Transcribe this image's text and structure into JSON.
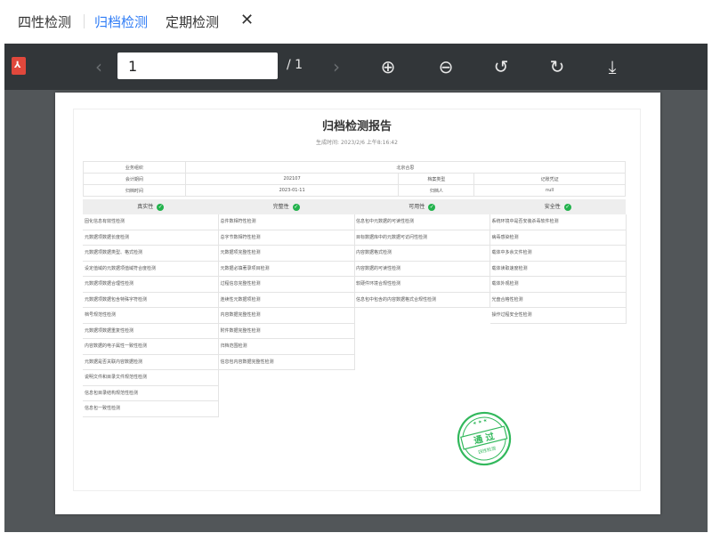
{
  "tabs": [
    "四性检测",
    "归档检测",
    "定期检测"
  ],
  "close_glyph": "✕",
  "toolbar": {
    "prev_icon": "‹",
    "page_value": "1",
    "page_total": "/ 1",
    "next_icon": "›",
    "zoom_in_icon": "⊕",
    "zoom_out_icon": "⊖",
    "rotate_left_icon": "↺",
    "rotate_right_icon": "↻",
    "download_icon": "⤓"
  },
  "report": {
    "title": "归档检测报告",
    "generated": "生成时间: 2023/2/6 上午8:16:42",
    "info_rows": [
      [
        "业务组织",
        "北京合思"
      ],
      [
        "会计期间",
        "202107",
        "档案类型",
        "记账凭证"
      ],
      [
        "归档时间",
        "2023-01-11",
        "归档人",
        "null"
      ]
    ],
    "categories": [
      "真实性",
      "完整性",
      "可用性",
      "安全性"
    ],
    "columns": [
      [
        "固化信息有效性检测",
        "元数据项数据长度检测",
        "元数据项数据类型、格式检测",
        "设定值域的元数据项值域符合度检测",
        "元数据项数据合理性检测",
        "元数据项数据包含特殊字符检测",
        "档号规范性检测",
        "元数据项数据重复性检测",
        "内容数据的电子属性一致性检测",
        "元数据是否关联内容数据检测",
        "说明文件和目录文件规范性检测",
        "信息包目录结构规范性检测",
        "信息包一致性检测"
      ],
      [
        "总件数相符性检测",
        "总字节数相符性检测",
        "元数据项完整性检测",
        "元数据必填著录项目检测",
        "过程信息完整性检测",
        "连续性元数据项检测",
        "内容数据完整性检测",
        "附件数据完整性检测",
        "归档范围检测",
        "信息包内容数据完整性检测"
      ],
      [
        "信息包中元数据的可读性检测",
        "目标数据库中的元数据可访问性检测",
        "内容数据格式检测",
        "内容数据的可读性检测",
        "软硬件环境合规性检测",
        "信息包中包含的内容数据格式合规性检测"
      ],
      [
        "系统环境中是否安装杀毒软件检测",
        "病毒感染检测",
        "载体中多余文件检测",
        "载体读取速度检测",
        "载体外观检测",
        "光盘合格性检测",
        "操作过程安全性检测"
      ]
    ],
    "stamp_text": "通 过",
    "stamp_sub": "四性检测"
  }
}
